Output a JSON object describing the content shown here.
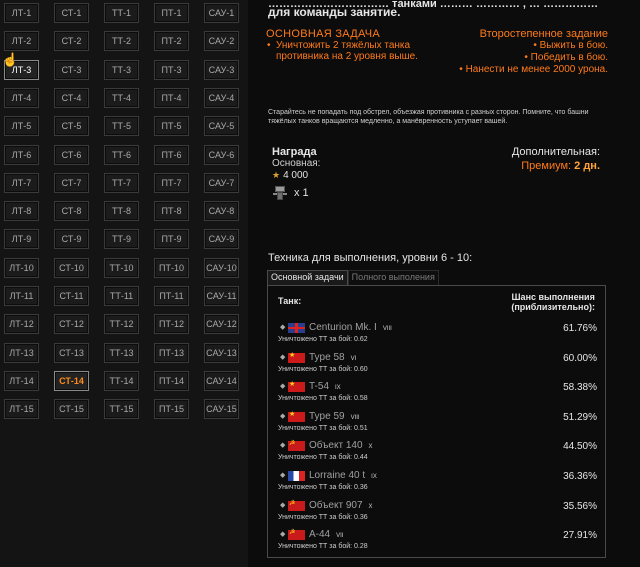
{
  "grid": {
    "rows": [
      [
        "ЛТ-1",
        "СТ-1",
        "ТТ-1",
        "ПТ-1",
        "САУ-1"
      ],
      [
        "ЛТ-2",
        "СТ-2",
        "ТТ-2",
        "ПТ-2",
        "САУ-2"
      ],
      [
        "ЛТ-3",
        "СТ-3",
        "ТТ-3",
        "ПТ-3",
        "САУ-3"
      ],
      [
        "ЛТ-4",
        "СТ-4",
        "ТТ-4",
        "ПТ-4",
        "САУ-4"
      ],
      [
        "ЛТ-5",
        "СТ-5",
        "ТТ-5",
        "ПТ-5",
        "САУ-5"
      ],
      [
        "ЛТ-6",
        "СТ-6",
        "ТТ-6",
        "ПТ-6",
        "САУ-6"
      ],
      [
        "ЛТ-7",
        "СТ-7",
        "ТТ-7",
        "ПТ-7",
        "САУ-7"
      ],
      [
        "ЛТ-8",
        "СТ-8",
        "ТТ-8",
        "ПТ-8",
        "САУ-8"
      ],
      [
        "ЛТ-9",
        "СТ-9",
        "ТТ-9",
        "ПТ-9",
        "САУ-9"
      ],
      [
        "ЛТ-10",
        "СТ-10",
        "ТТ-10",
        "ПТ-10",
        "САУ-10"
      ],
      [
        "ЛТ-11",
        "СТ-11",
        "ТТ-11",
        "ПТ-11",
        "САУ-11"
      ],
      [
        "ЛТ-12",
        "СТ-12",
        "ТТ-12",
        "ПТ-12",
        "САУ-12"
      ],
      [
        "ЛТ-13",
        "СТ-13",
        "ТТ-13",
        "ПТ-13",
        "САУ-13"
      ],
      [
        "ЛТ-14",
        "СТ-14",
        "ТТ-14",
        "ПТ-14",
        "САУ-14"
      ],
      [
        "ЛТ-15",
        "СТ-15",
        "ТТ-15",
        "ПТ-15",
        "САУ-15"
      ]
    ],
    "selected": "ЛТ-3",
    "active": "СТ-14"
  },
  "header": {
    "line1": "…………………………… танками ……… ………… , … ……………",
    "line2": "для команды занятие."
  },
  "main_task": {
    "title": "ОСНОВНАЯ ЗАДАЧА",
    "items": [
      "Уничтожить 2 тяжёлых танка противника на 2 уровня выше."
    ]
  },
  "secondary_task": {
    "title": "Второстепенное задание",
    "items": [
      "Выжить в бою.",
      "Победить в бою.",
      "Нанести не менее 2000 урона."
    ]
  },
  "hint": "Старайтесь не попадать под обстрел, объезжая противника с разных сторон. Помните, что башни тяжёлых танков вращаются медленно, а манёвренность уступает вашей.",
  "reward": {
    "title": "Награда",
    "main_label": "Основная:",
    "credits": "4 000",
    "item_count": "x 1"
  },
  "extra_reward": {
    "title": "Дополнительная:",
    "premium_label": "Премиум:",
    "premium_value": "2 дн."
  },
  "tech": {
    "title": "Техника для выполнения, уровни 6 - 10:",
    "tabs": [
      "Основной задачи",
      "Полного выполения"
    ],
    "col_tank": "Танк:",
    "col_chance_line1": "Шанс выполнения",
    "col_chance_line2": "(приблизительно):",
    "rows": [
      {
        "flag": "gb",
        "name": "Centurion Mk. I",
        "tier": "VIII",
        "kills": "Уничтожено ТТ за бой: 0.62",
        "pct": "61.76%"
      },
      {
        "flag": "cn",
        "name": "Type 58",
        "tier": "VI",
        "kills": "Уничтожено ТТ за бой: 0.60",
        "pct": "60.00%"
      },
      {
        "flag": "cn",
        "name": "T-54",
        "tier": "IX",
        "kills": "Уничтожено ТТ за бой: 0.58",
        "pct": "58.38%"
      },
      {
        "flag": "cn",
        "name": "Type 59",
        "tier": "VIII",
        "kills": "Уничтожено ТТ за бой: 0.51",
        "pct": "51.29%"
      },
      {
        "flag": "su",
        "name": "Объект 140",
        "tier": "X",
        "kills": "Уничтожено ТТ за бой: 0.44",
        "pct": "44.50%"
      },
      {
        "flag": "fr",
        "name": "Lorraine 40 t",
        "tier": "IX",
        "kills": "Уничтожено ТТ за бой: 0.36",
        "pct": "36.36%"
      },
      {
        "flag": "su",
        "name": "Объект 907",
        "tier": "X",
        "kills": "Уничтожено ТТ за бой: 0.36",
        "pct": "35.56%"
      },
      {
        "flag": "su",
        "name": "A-44",
        "tier": "VII",
        "kills": "Уничтожено ТТ за бой: 0.28",
        "pct": "27.91%"
      }
    ]
  }
}
